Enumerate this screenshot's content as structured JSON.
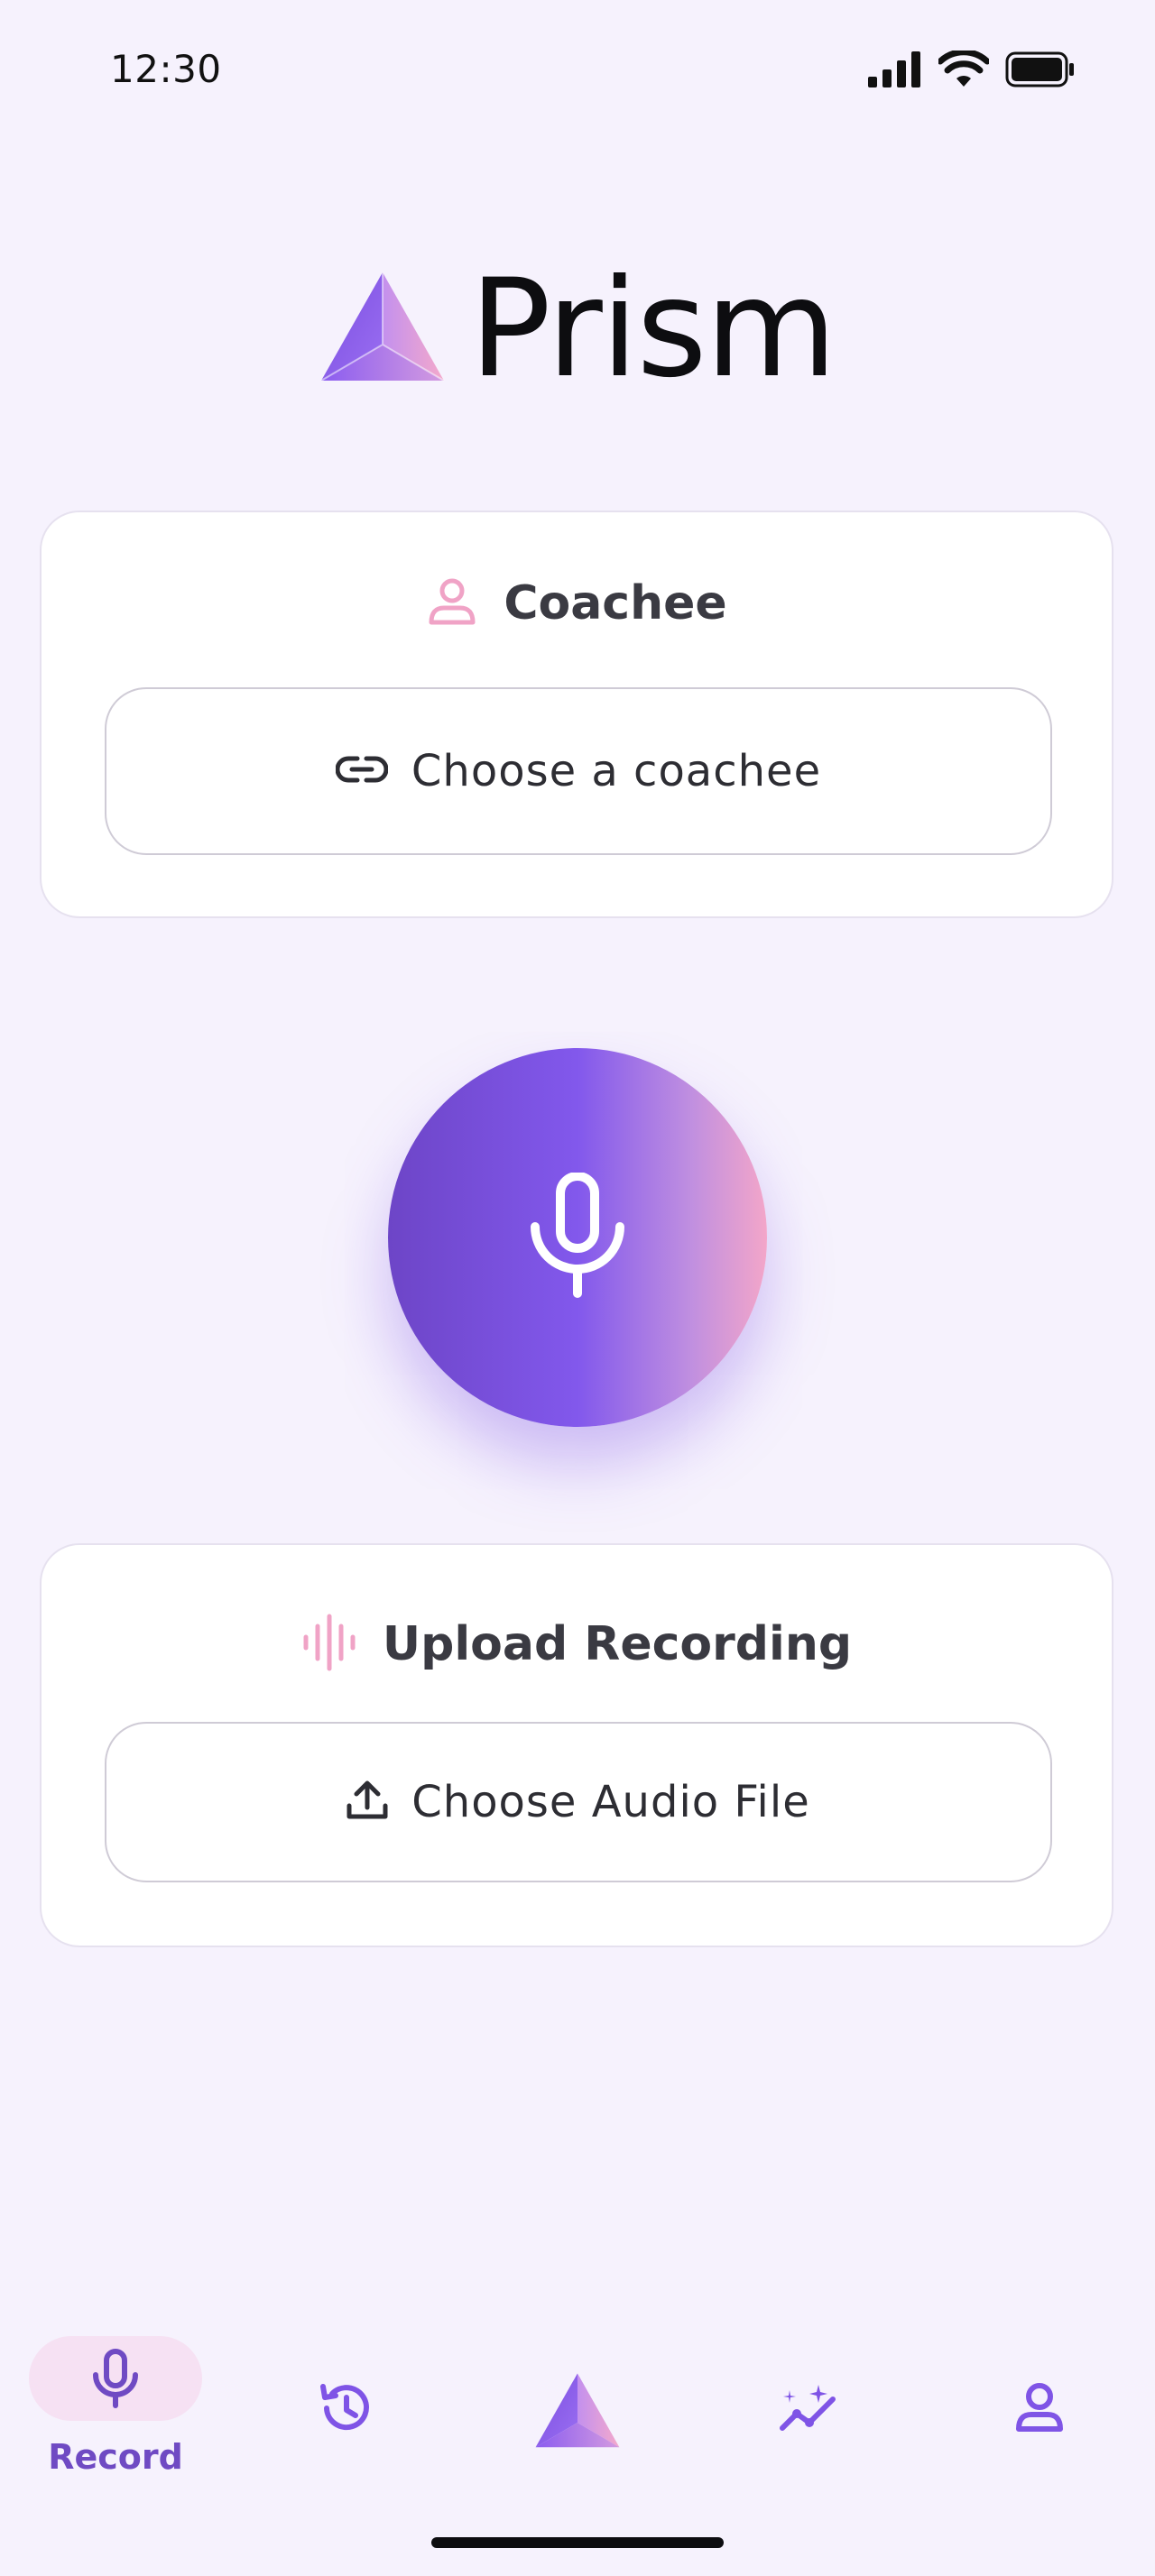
{
  "status_bar": {
    "time": "12:30"
  },
  "app": {
    "name": "Prism"
  },
  "coachee_card": {
    "title": "Coachee",
    "button_label": "Choose a coachee"
  },
  "upload_card": {
    "title": "Upload Recording",
    "button_label": "Choose Audio File"
  },
  "bottom_nav": {
    "items": [
      {
        "label": "Record",
        "icon": "mic-icon",
        "active": true
      },
      {
        "label": "",
        "icon": "history-icon",
        "active": false
      },
      {
        "label": "",
        "icon": "prism-logo-icon",
        "active": false
      },
      {
        "label": "",
        "icon": "insights-icon",
        "active": false
      },
      {
        "label": "",
        "icon": "profile-icon",
        "active": false
      }
    ]
  },
  "colors": {
    "accent": "#7f54e6",
    "accent_dark": "#6f4ac3",
    "pink": "#f3a6c9",
    "background": "#f6f2fd"
  }
}
